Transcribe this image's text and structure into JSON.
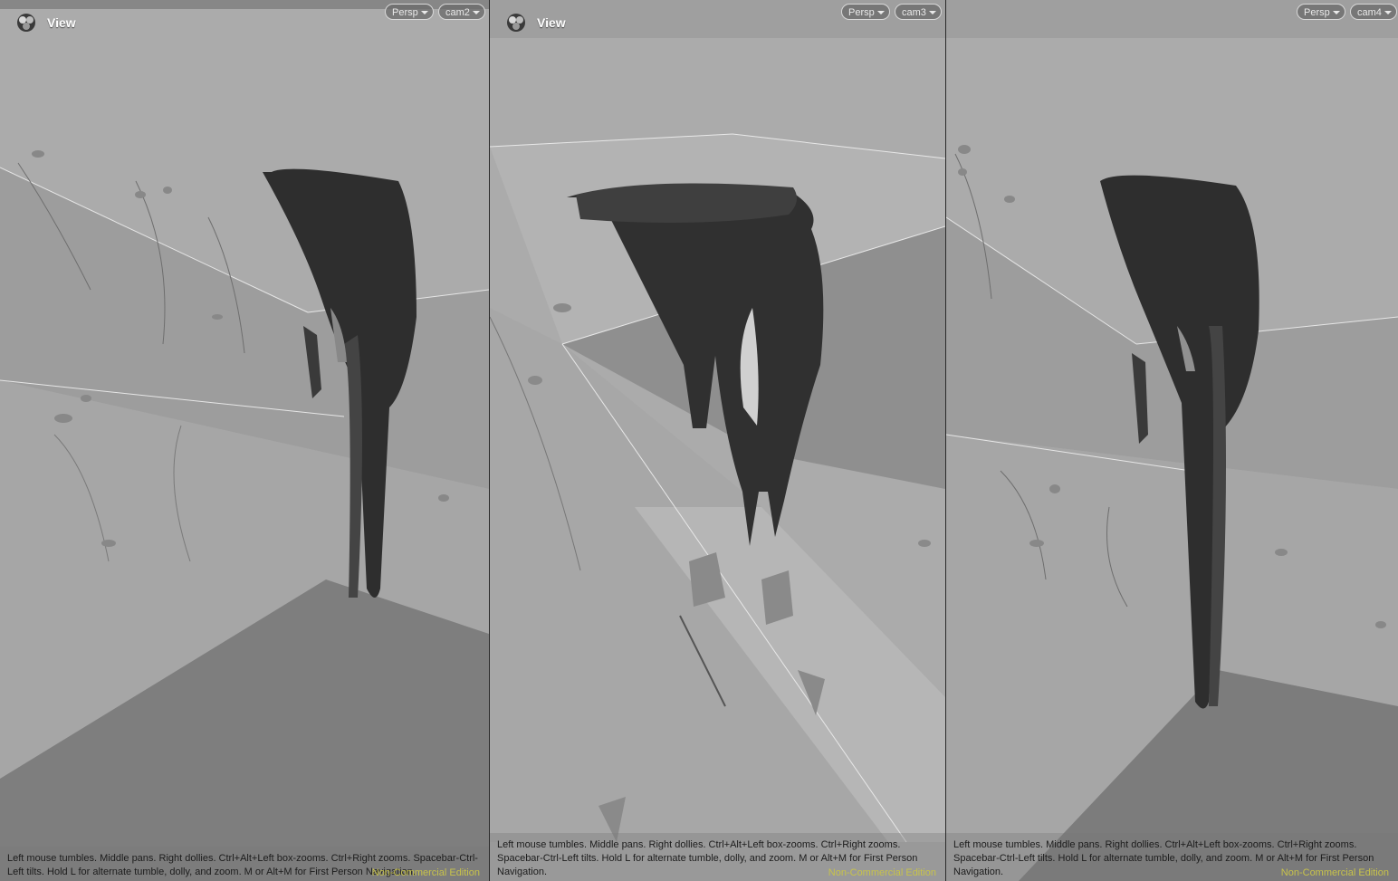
{
  "viewports": [
    {
      "view_label": "View",
      "projection": "Persp",
      "camera": "cam2",
      "hint": "Left mouse tumbles. Middle pans. Right dollies. Ctrl+Alt+Left box-zooms. Ctrl+Right zooms. Spacebar-Ctrl-Left tilts. Hold L for alternate tumble, dolly, and zoom. M or Alt+M for First Person Navigation.",
      "edition": "Non-Commercial Edition"
    },
    {
      "view_label": "View",
      "projection": "Persp",
      "camera": "cam3",
      "hint": "Left mouse tumbles. Middle pans. Right dollies. Ctrl+Alt+Left box-zooms. Ctrl+Right zooms. Spacebar-Ctrl-Left tilts. Hold L for alternate tumble, dolly, and zoom. M or Alt+M for First Person Navigation.",
      "edition": "Non-Commercial Edition"
    },
    {
      "view_label": "",
      "projection": "Persp",
      "camera": "cam4",
      "hint": "Left mouse tumbles. Middle pans. Right dollies. Ctrl+Alt+Left box-zooms. Ctrl+Right zooms. Spacebar-Ctrl-Left tilts. Hold L for alternate tumble, dolly, and zoom. M or Alt+M for First Person Navigation.",
      "edition": "Non-Commercial Edition"
    }
  ],
  "icons": {
    "view_logo": "houdini-logo-icon",
    "dropdown": "chevron-down-icon"
  },
  "colors": {
    "background": "#a9a9a9",
    "sculpture": "#2d2d2d",
    "edition_text": "#c8c34a",
    "hint_text": "#1c1c1c"
  }
}
